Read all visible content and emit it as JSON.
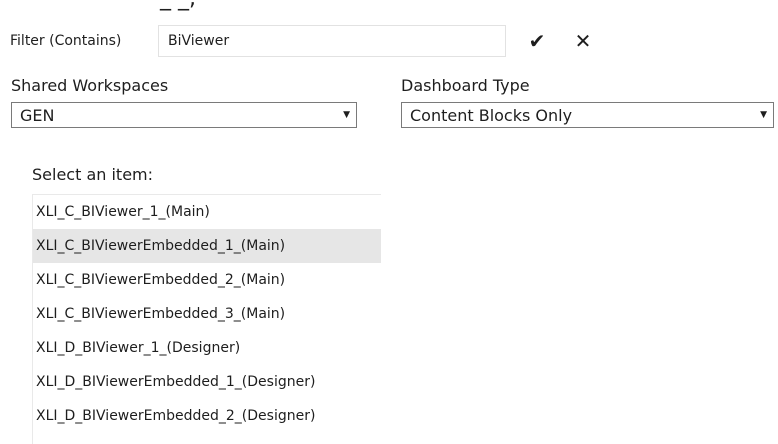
{
  "top_clip_text": "_ _, · · · · · · · · · · ·",
  "filter": {
    "label": "Filter (Contains)",
    "value": "BiViewer",
    "apply_glyph": "✔",
    "clear_glyph": "✕"
  },
  "workspaces": {
    "label": "Shared Workspaces",
    "selected": "GEN"
  },
  "dashboard_type": {
    "label": "Dashboard Type",
    "selected": "Content Blocks Only"
  },
  "dropdown_arrow": "▼",
  "list": {
    "label": "Select an item:",
    "selected_index": 1,
    "items": [
      "XLI_C_BIViewer_1_(Main)",
      "XLI_C_BIViewerEmbedded_1_(Main)",
      "XLI_C_BIViewerEmbedded_2_(Main)",
      "XLI_C_BIViewerEmbedded_3_(Main)",
      "XLI_D_BIViewer_1_(Designer)",
      "XLI_D_BIViewerEmbedded_1_(Designer)",
      "XLI_D_BIViewerEmbedded_2_(Designer)"
    ]
  }
}
